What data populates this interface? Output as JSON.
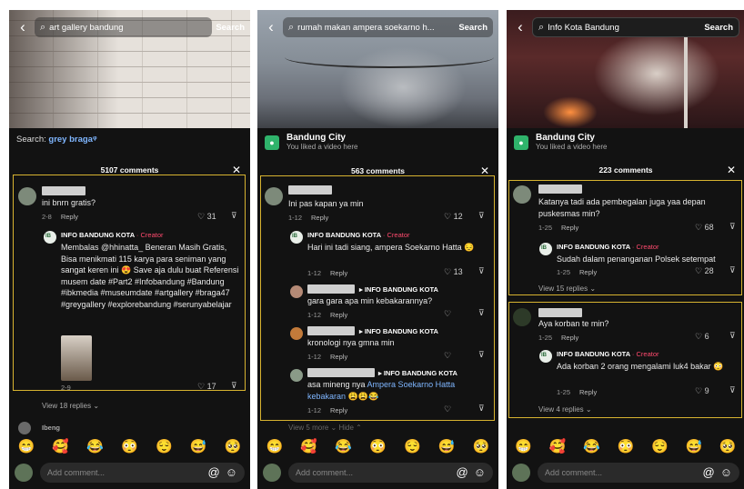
{
  "common": {
    "emojis": [
      "😁",
      "🥰",
      "😂",
      "😳",
      "😌",
      "😅",
      "🥺"
    ],
    "add_comment": "Add comment...",
    "at_icon": "@",
    "emoji_icon": "☺",
    "search_label": "Search",
    "close": "✕",
    "heart": "♡",
    "dislike": "⊽"
  },
  "panel1": {
    "search_query": "art gallery bandung",
    "search_prefix": "Search:",
    "search_term": "grey braga",
    "comments_count": "5107 comments",
    "c1": {
      "text": "ini bnrn gratis?",
      "date": "2-8",
      "reply": "Reply",
      "likes": "31"
    },
    "c2": {
      "author": "INFO BANDUNG KOTA",
      "badge": "· Creator",
      "text": "Membalas @hhinatta_ Beneran Masih Gratis, Bisa menikmati 115 karya para seniman yang sangat keren ini 😍 Save aja dulu buat Referensi musem date #Part2 #Infobandung #Bandung #ibkmedia #museumdate #artgallery #braga47 #greygallery #explorebandung #serunyabelajar",
      "date": "2-9",
      "likes": "17"
    },
    "view_replies": "View 18 replies ⌄",
    "peek_name": "Ibeng"
  },
  "panel2": {
    "search_query": "rumah makan ampera soekarno h...",
    "location_name": "Bandung City",
    "location_sub": "You liked a video here",
    "comments_count": "563 comments",
    "c1": {
      "text": "Ini pas kapan ya min",
      "date": "1-12",
      "reply": "Reply",
      "likes": "12"
    },
    "c2": {
      "author": "INFO BANDUNG KOTA",
      "badge": "· Creator",
      "text": "Hari ini tadi siang, ampera Soekarno Hatta 😔",
      "date": "1-12",
      "reply": "Reply",
      "likes": "13"
    },
    "c3": {
      "reply_to": "▸ INFO BANDUNG KOTA",
      "text": "gara gara apa min kebakarannya?",
      "date": "1-12",
      "reply": "Reply"
    },
    "c4": {
      "reply_to": "▸ INFO BANDUNG KOTA",
      "text": "kronologi nya gmna min",
      "date": "1-12",
      "reply": "Reply"
    },
    "c5": {
      "reply_to": "▸ INFO BANDUNG KOTA",
      "text_a": "asa mineng nya ",
      "text_link": "Ampera Soekarno Hatta kebakaran",
      "text_b": " 😩😩😂",
      "date": "1-12",
      "reply": "Reply"
    },
    "peek": "View 5 more ⌄   Hide ⌃"
  },
  "panel3": {
    "search_query": "Info Kota Bandung",
    "location_name": "Bandung City",
    "location_sub": "You liked a video here",
    "comments_count": "223 comments",
    "c1": {
      "text": "Katanya tadi ada pembegalan juga yaa depan puskesmas min?",
      "date": "1-25",
      "reply": "Reply",
      "likes": "68"
    },
    "c2": {
      "author": "INFO BANDUNG KOTA",
      "badge": "· Creator",
      "text": "Sudah dalam penanganan Polsek setempat",
      "date": "1-25",
      "reply": "Reply",
      "likes": "28"
    },
    "view_replies_1": "View 15 replies ⌄",
    "c3": {
      "text": "Aya korban te min?",
      "date": "1-25",
      "reply": "Reply",
      "likes": "6"
    },
    "c4": {
      "author": "INFO BANDUNG KOTA",
      "badge": "· Creator",
      "text": "Ada korban 2 orang mengalami luk4 bakar 😳",
      "date": "1-25",
      "reply": "Reply",
      "likes": "9"
    },
    "view_replies_2": "View 4 replies ⌄"
  }
}
